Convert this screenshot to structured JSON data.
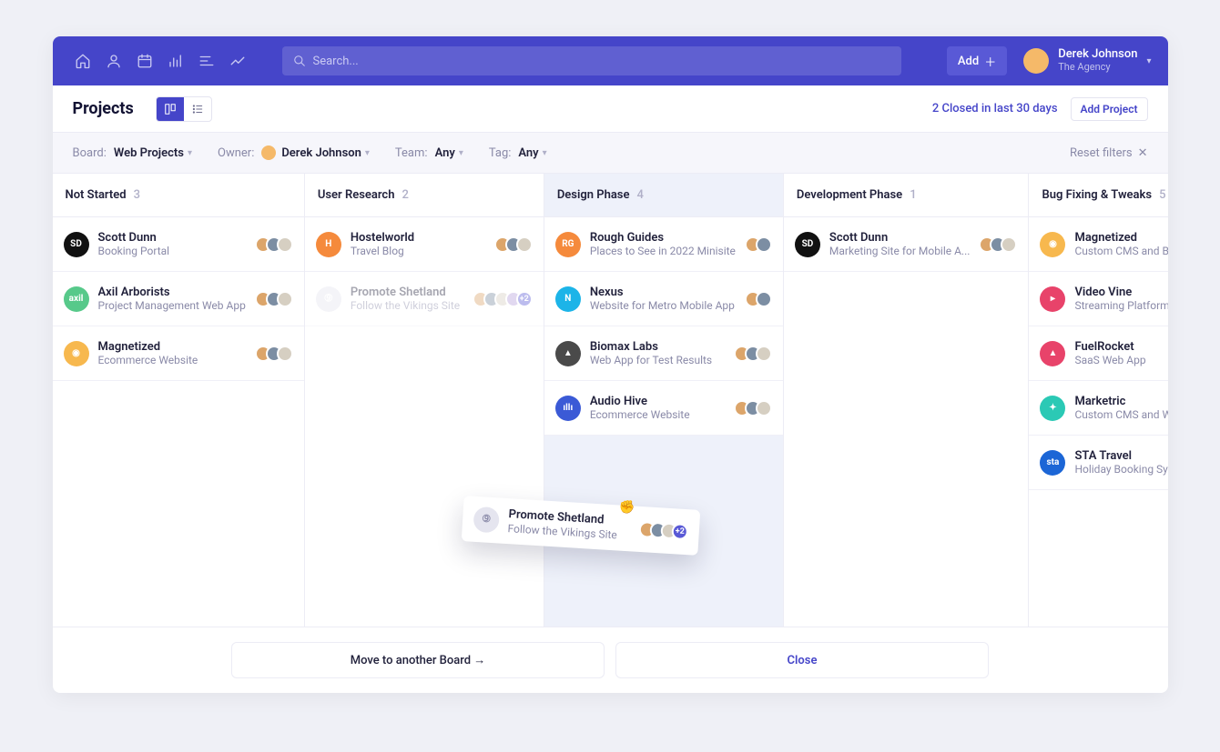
{
  "header": {
    "search_placeholder": "Search...",
    "add_label": "Add",
    "user_name": "Derek Johnson",
    "user_sub": "The Agency"
  },
  "subbar": {
    "page_title": "Projects",
    "closed_text": "2 Closed in last 30 days",
    "add_project": "Add Project"
  },
  "filters": {
    "board_lbl": "Board:",
    "board_val": "Web Projects",
    "owner_lbl": "Owner:",
    "owner_val": "Derek Johnson",
    "team_lbl": "Team:",
    "team_val": "Any",
    "tag_lbl": "Tag:",
    "tag_val": "Any",
    "reset": "Reset filters"
  },
  "columns": [
    {
      "title": "Not Started",
      "count": "3",
      "cards": [
        {
          "t": "Scott Dunn",
          "s": "Booking Portal",
          "bg": "#111",
          "lg": "SD",
          "avs": 3
        },
        {
          "t": "Axil Arborists",
          "s": "Project Management Web App",
          "bg": "#57c98a",
          "lg": "axil",
          "avs": 3
        },
        {
          "t": "Magnetized",
          "s": "Ecommerce Website",
          "bg": "#f7b84e",
          "lg": "◉",
          "avs": 3
        }
      ]
    },
    {
      "title": "User Research",
      "count": "2",
      "cards": [
        {
          "t": "Hostelworld",
          "s": "Travel Blog",
          "bg": "#f58a3c",
          "lg": "H",
          "avs": 3
        },
        {
          "t": "Promote Shetland",
          "s": "Follow the Vikings Site",
          "bg": "#e5e5ef",
          "lg": "➈",
          "avs": 4,
          "extra": "+2",
          "faded": true
        }
      ]
    },
    {
      "title": "Design Phase",
      "count": "4",
      "dragover": true,
      "cards": [
        {
          "t": "Rough Guides",
          "s": "Places to See in 2022 Minisite",
          "bg": "#f58a3c",
          "lg": "RG",
          "avs": 2
        },
        {
          "t": "Nexus",
          "s": "Website for Metro Mobile App",
          "bg": "#1cb4e8",
          "lg": "N",
          "avs": 2
        },
        {
          "t": "Biomax Labs",
          "s": "Web App for Test Results",
          "bg": "#4a4a4a",
          "lg": "▲",
          "avs": 3
        },
        {
          "t": "Audio Hive",
          "s": "Ecommerce Website",
          "bg": "#3b5ad6",
          "lg": "ıllı",
          "avs": 3
        }
      ]
    },
    {
      "title": "Development Phase",
      "count": "1",
      "cards": [
        {
          "t": "Scott Dunn",
          "s": "Marketing Site for Mobile A...",
          "bg": "#111",
          "lg": "SD",
          "avs": 3
        }
      ]
    },
    {
      "title": "Bug Fixing & Tweaks",
      "count": "5",
      "cards": [
        {
          "t": "Magnetized",
          "s": "Custom CMS and Blog",
          "bg": "#f7b84e",
          "lg": "◉",
          "avs": 0
        },
        {
          "t": "Video Vine",
          "s": "Streaming Platform",
          "bg": "#e8436a",
          "lg": "▸",
          "avs": 0
        },
        {
          "t": "FuelRocket",
          "s": "SaaS Web App",
          "bg": "#e8436a",
          "lg": "▲",
          "avs": 0
        },
        {
          "t": "Marketric",
          "s": "Custom CMS and Websi",
          "bg": "#2bc9b5",
          "lg": "✦",
          "avs": 0
        },
        {
          "t": "STA Travel",
          "s": "Holiday Booking System",
          "bg": "#1c66d6",
          "lg": "sta",
          "avs": 0
        }
      ]
    }
  ],
  "floating": {
    "t": "Promote Shetland",
    "s": "Follow the Vikings Site",
    "extra": "+2"
  },
  "bottom": {
    "move": "Move to another Board →",
    "close": "Close"
  }
}
